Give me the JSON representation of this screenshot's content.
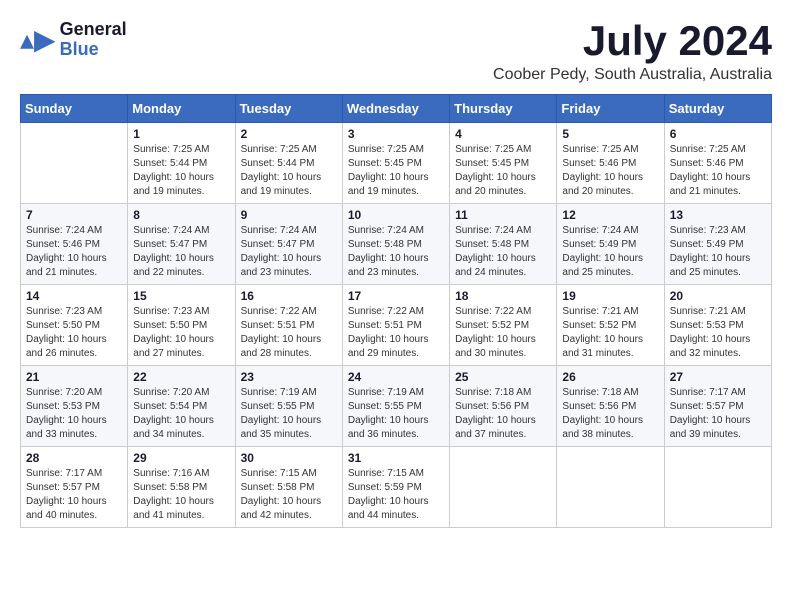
{
  "header": {
    "logo": {
      "general": "General",
      "blue": "Blue"
    },
    "title": "July 2024",
    "location": "Coober Pedy, South Australia, Australia"
  },
  "calendar": {
    "days": [
      "Sunday",
      "Monday",
      "Tuesday",
      "Wednesday",
      "Thursday",
      "Friday",
      "Saturday"
    ],
    "weeks": [
      [
        {
          "day": null,
          "number": "",
          "sunrise": "",
          "sunset": "",
          "daylight": ""
        },
        {
          "day": "Mon",
          "number": "1",
          "sunrise": "Sunrise: 7:25 AM",
          "sunset": "Sunset: 5:44 PM",
          "daylight": "Daylight: 10 hours and 19 minutes."
        },
        {
          "day": "Tue",
          "number": "2",
          "sunrise": "Sunrise: 7:25 AM",
          "sunset": "Sunset: 5:44 PM",
          "daylight": "Daylight: 10 hours and 19 minutes."
        },
        {
          "day": "Wed",
          "number": "3",
          "sunrise": "Sunrise: 7:25 AM",
          "sunset": "Sunset: 5:45 PM",
          "daylight": "Daylight: 10 hours and 19 minutes."
        },
        {
          "day": "Thu",
          "number": "4",
          "sunrise": "Sunrise: 7:25 AM",
          "sunset": "Sunset: 5:45 PM",
          "daylight": "Daylight: 10 hours and 20 minutes."
        },
        {
          "day": "Fri",
          "number": "5",
          "sunrise": "Sunrise: 7:25 AM",
          "sunset": "Sunset: 5:46 PM",
          "daylight": "Daylight: 10 hours and 20 minutes."
        },
        {
          "day": "Sat",
          "number": "6",
          "sunrise": "Sunrise: 7:25 AM",
          "sunset": "Sunset: 5:46 PM",
          "daylight": "Daylight: 10 hours and 21 minutes."
        }
      ],
      [
        {
          "day": "Sun",
          "number": "7",
          "sunrise": "Sunrise: 7:24 AM",
          "sunset": "Sunset: 5:46 PM",
          "daylight": "Daylight: 10 hours and 21 minutes."
        },
        {
          "day": "Mon",
          "number": "8",
          "sunrise": "Sunrise: 7:24 AM",
          "sunset": "Sunset: 5:47 PM",
          "daylight": "Daylight: 10 hours and 22 minutes."
        },
        {
          "day": "Tue",
          "number": "9",
          "sunrise": "Sunrise: 7:24 AM",
          "sunset": "Sunset: 5:47 PM",
          "daylight": "Daylight: 10 hours and 23 minutes."
        },
        {
          "day": "Wed",
          "number": "10",
          "sunrise": "Sunrise: 7:24 AM",
          "sunset": "Sunset: 5:48 PM",
          "daylight": "Daylight: 10 hours and 23 minutes."
        },
        {
          "day": "Thu",
          "number": "11",
          "sunrise": "Sunrise: 7:24 AM",
          "sunset": "Sunset: 5:48 PM",
          "daylight": "Daylight: 10 hours and 24 minutes."
        },
        {
          "day": "Fri",
          "number": "12",
          "sunrise": "Sunrise: 7:24 AM",
          "sunset": "Sunset: 5:49 PM",
          "daylight": "Daylight: 10 hours and 25 minutes."
        },
        {
          "day": "Sat",
          "number": "13",
          "sunrise": "Sunrise: 7:23 AM",
          "sunset": "Sunset: 5:49 PM",
          "daylight": "Daylight: 10 hours and 25 minutes."
        }
      ],
      [
        {
          "day": "Sun",
          "number": "14",
          "sunrise": "Sunrise: 7:23 AM",
          "sunset": "Sunset: 5:50 PM",
          "daylight": "Daylight: 10 hours and 26 minutes."
        },
        {
          "day": "Mon",
          "number": "15",
          "sunrise": "Sunrise: 7:23 AM",
          "sunset": "Sunset: 5:50 PM",
          "daylight": "Daylight: 10 hours and 27 minutes."
        },
        {
          "day": "Tue",
          "number": "16",
          "sunrise": "Sunrise: 7:22 AM",
          "sunset": "Sunset: 5:51 PM",
          "daylight": "Daylight: 10 hours and 28 minutes."
        },
        {
          "day": "Wed",
          "number": "17",
          "sunrise": "Sunrise: 7:22 AM",
          "sunset": "Sunset: 5:51 PM",
          "daylight": "Daylight: 10 hours and 29 minutes."
        },
        {
          "day": "Thu",
          "number": "18",
          "sunrise": "Sunrise: 7:22 AM",
          "sunset": "Sunset: 5:52 PM",
          "daylight": "Daylight: 10 hours and 30 minutes."
        },
        {
          "day": "Fri",
          "number": "19",
          "sunrise": "Sunrise: 7:21 AM",
          "sunset": "Sunset: 5:52 PM",
          "daylight": "Daylight: 10 hours and 31 minutes."
        },
        {
          "day": "Sat",
          "number": "20",
          "sunrise": "Sunrise: 7:21 AM",
          "sunset": "Sunset: 5:53 PM",
          "daylight": "Daylight: 10 hours and 32 minutes."
        }
      ],
      [
        {
          "day": "Sun",
          "number": "21",
          "sunrise": "Sunrise: 7:20 AM",
          "sunset": "Sunset: 5:53 PM",
          "daylight": "Daylight: 10 hours and 33 minutes."
        },
        {
          "day": "Mon",
          "number": "22",
          "sunrise": "Sunrise: 7:20 AM",
          "sunset": "Sunset: 5:54 PM",
          "daylight": "Daylight: 10 hours and 34 minutes."
        },
        {
          "day": "Tue",
          "number": "23",
          "sunrise": "Sunrise: 7:19 AM",
          "sunset": "Sunset: 5:55 PM",
          "daylight": "Daylight: 10 hours and 35 minutes."
        },
        {
          "day": "Wed",
          "number": "24",
          "sunrise": "Sunrise: 7:19 AM",
          "sunset": "Sunset: 5:55 PM",
          "daylight": "Daylight: 10 hours and 36 minutes."
        },
        {
          "day": "Thu",
          "number": "25",
          "sunrise": "Sunrise: 7:18 AM",
          "sunset": "Sunset: 5:56 PM",
          "daylight": "Daylight: 10 hours and 37 minutes."
        },
        {
          "day": "Fri",
          "number": "26",
          "sunrise": "Sunrise: 7:18 AM",
          "sunset": "Sunset: 5:56 PM",
          "daylight": "Daylight: 10 hours and 38 minutes."
        },
        {
          "day": "Sat",
          "number": "27",
          "sunrise": "Sunrise: 7:17 AM",
          "sunset": "Sunset: 5:57 PM",
          "daylight": "Daylight: 10 hours and 39 minutes."
        }
      ],
      [
        {
          "day": "Sun",
          "number": "28",
          "sunrise": "Sunrise: 7:17 AM",
          "sunset": "Sunset: 5:57 PM",
          "daylight": "Daylight: 10 hours and 40 minutes."
        },
        {
          "day": "Mon",
          "number": "29",
          "sunrise": "Sunrise: 7:16 AM",
          "sunset": "Sunset: 5:58 PM",
          "daylight": "Daylight: 10 hours and 41 minutes."
        },
        {
          "day": "Tue",
          "number": "30",
          "sunrise": "Sunrise: 7:15 AM",
          "sunset": "Sunset: 5:58 PM",
          "daylight": "Daylight: 10 hours and 42 minutes."
        },
        {
          "day": "Wed",
          "number": "31",
          "sunrise": "Sunrise: 7:15 AM",
          "sunset": "Sunset: 5:59 PM",
          "daylight": "Daylight: 10 hours and 44 minutes."
        },
        {
          "day": null,
          "number": "",
          "sunrise": "",
          "sunset": "",
          "daylight": ""
        },
        {
          "day": null,
          "number": "",
          "sunrise": "",
          "sunset": "",
          "daylight": ""
        },
        {
          "day": null,
          "number": "",
          "sunrise": "",
          "sunset": "",
          "daylight": ""
        }
      ]
    ]
  }
}
